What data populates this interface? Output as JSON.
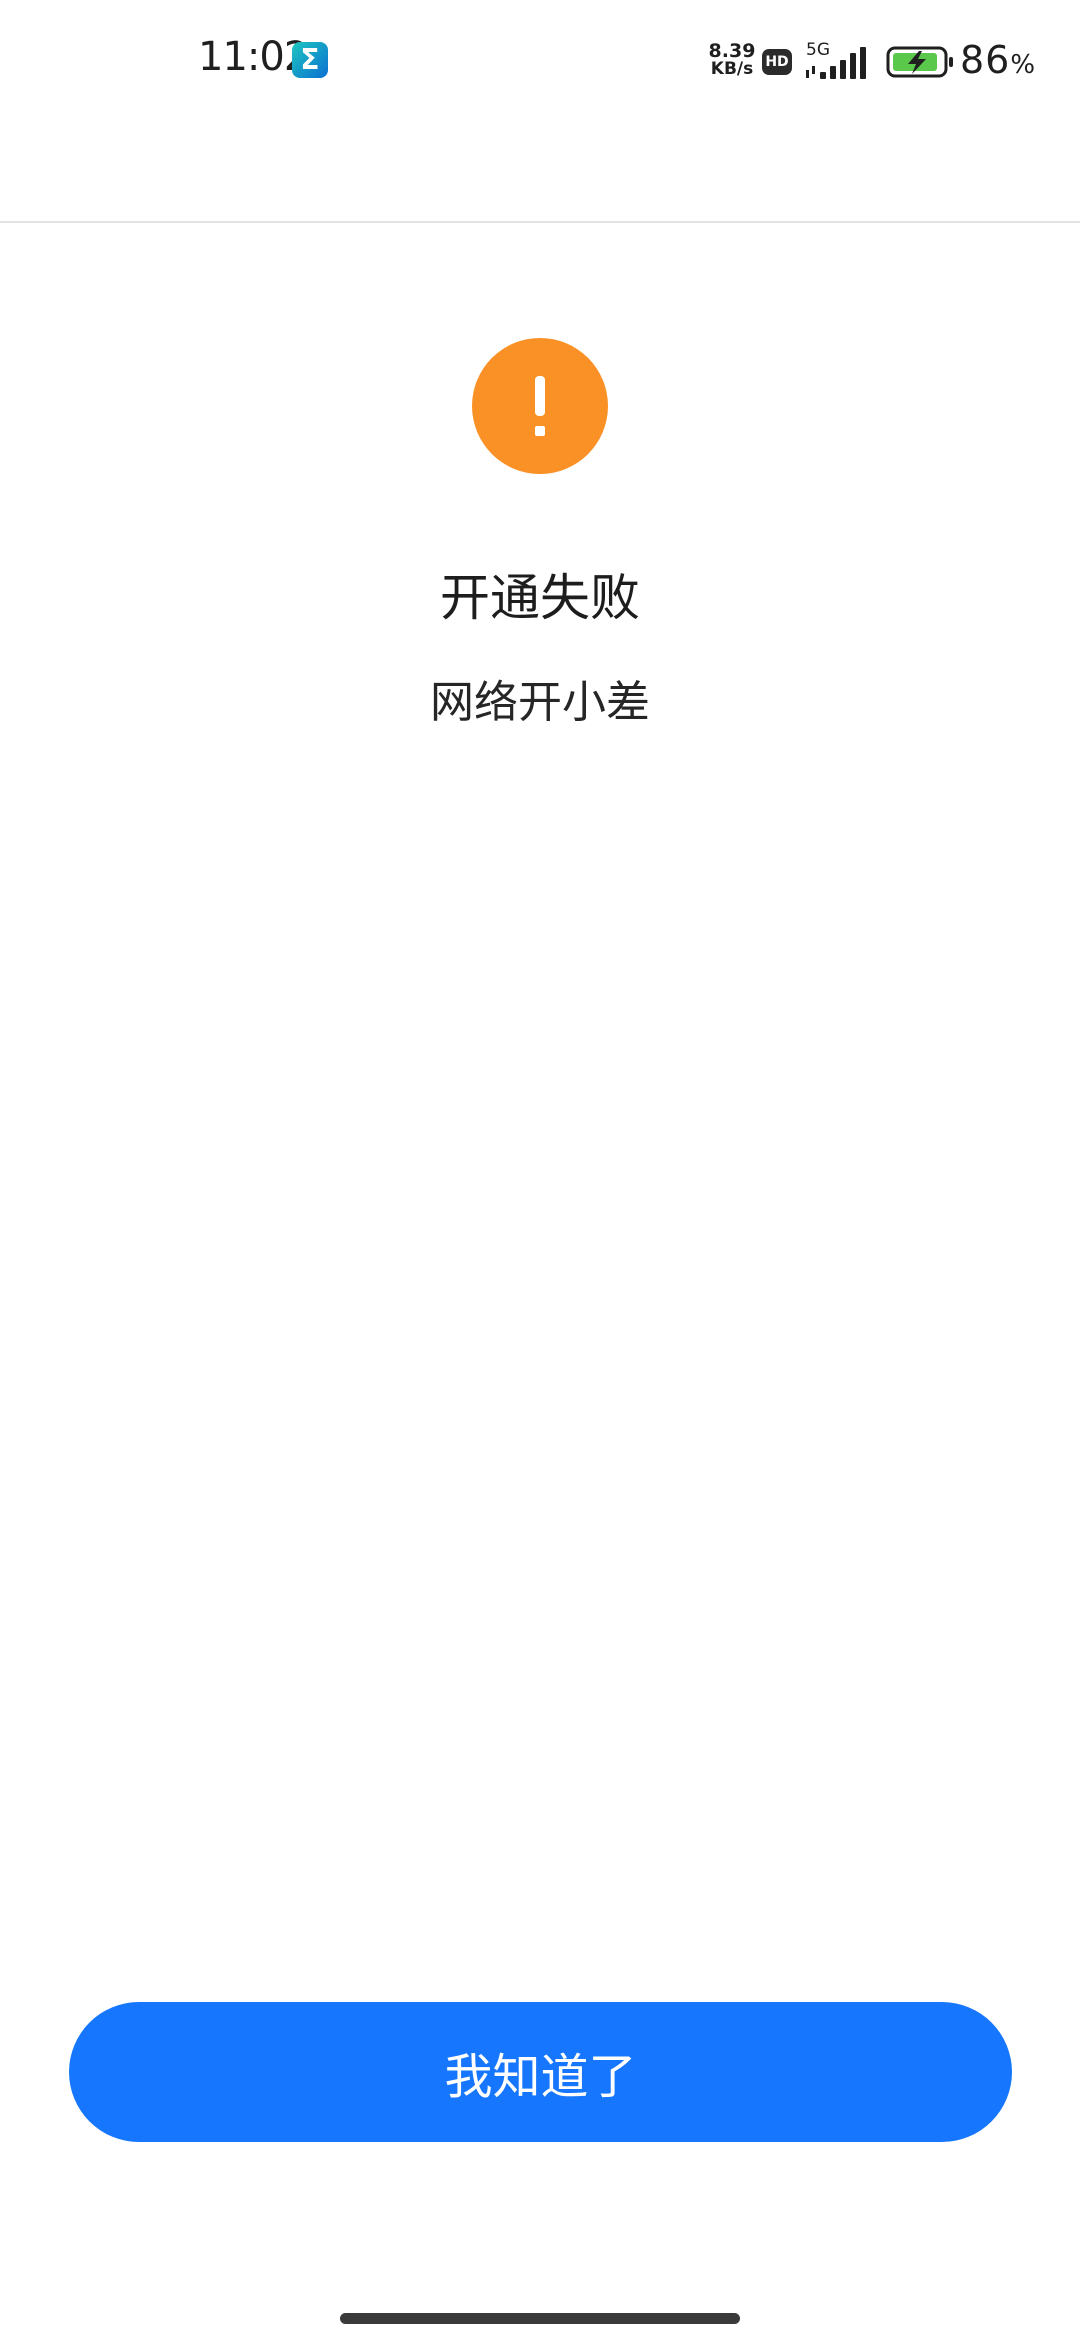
{
  "status_bar": {
    "time": "11:02",
    "app_icon_glyph": "Σ",
    "net_speed_value": "8.39",
    "net_speed_unit": "KB/s",
    "hd_label": "HD",
    "network_type": "5G",
    "battery_percent": "86",
    "battery_percent_sign": "%"
  },
  "result": {
    "icon": "exclamation-icon",
    "title": "开通失败",
    "description": "网络开小差"
  },
  "actions": {
    "confirm_label": "我知道了"
  },
  "colors": {
    "accent": "#1677fe",
    "warning": "#fa9126",
    "battery_charging": "#5ac84b"
  }
}
